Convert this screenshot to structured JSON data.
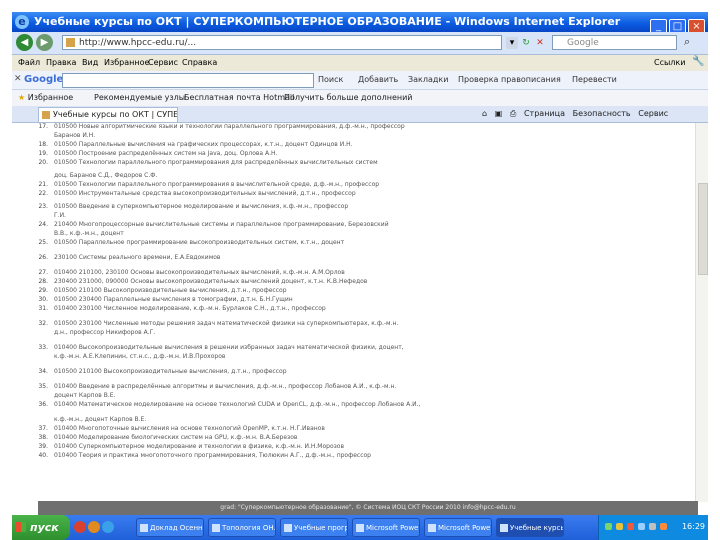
{
  "window": {
    "title": "Учебные курсы по ОКТ | СУПЕРКОМПЬЮТЕРНОЕ ОБРАЗОВАНИЕ - Windows Internet Explorer"
  },
  "address_bar": {
    "url": "http://www.hpcc-edu.ru/...",
    "search_placeholder": "Google"
  },
  "menu": [
    "Файл",
    "Правка",
    "Вид",
    "Избранное",
    "Сервис",
    "Справка"
  ],
  "menu_links": "Ссылки",
  "google_bar": {
    "logo": "Google",
    "buttons": [
      "Поиск",
      "Добавить",
      "Закладки",
      "Проверка правописания",
      "Перевести"
    ]
  },
  "favorites_bar": {
    "label": "Избранное",
    "items": [
      "Рекомендуемые узлы",
      "Бесплатная почта Hotmail",
      "Получить больше дополнений"
    ]
  },
  "tab": {
    "label": "Учебные курсы по ОКТ | СУПЕРКОМПЬЮТЕР..."
  },
  "command_bar": [
    "Страница",
    "Безопасность",
    "Сервис"
  ],
  "content": {
    "lines": [
      {
        "n": "17.",
        "t": "010500 Новые алгоритмические языки и технологии параллельного программирования, д.ф.-м.н., профессор"
      },
      {
        "n": "",
        "t": "Баранов И.Н."
      },
      {
        "n": "18.",
        "t": "010500 Параллельные вычисления на графических процессорах, к.т.н., доцент Одинцов И.Н."
      },
      {
        "n": "19.",
        "t": "010500 Построение распределённых систем на Java, доц. Орлова А.Н."
      },
      {
        "n": "20.",
        "t": "010500 Технологии параллельного программирования для распределённых вычислительных систем"
      },
      {
        "n": "",
        "t": "доц. Баранов С.Д., Федоров С.Ф."
      },
      {
        "n": "21.",
        "t": "010500 Технологии параллельного программирования в вычислительной среде, д.ф.-м.н., профессор"
      },
      {
        "n": "22.",
        "t": "010500 Инструментальные средства высокопроизводительных вычислений, д.т.н., профессор"
      },
      {
        "n": "23.",
        "t": "010500 Введение в суперкомпьютерное моделирование и вычисления, к.ф.-м.н., профессор"
      },
      {
        "n": "",
        "t": "Г.И."
      },
      {
        "n": "24.",
        "t": "210400 Многопроцессорные вычислительные системы и параллельное программирование, Березовский"
      },
      {
        "n": "",
        "t": "В.В., к.ф.-м.н., доцент"
      },
      {
        "n": "25.",
        "t": "010500 Параллельное программирование высокопроизводительных систем, к.т.н., доцент"
      },
      {
        "n": "26.",
        "t": "230100 Системы реального времени, Е.А.Евдокимов"
      },
      {
        "n": "27.",
        "t": "010400 210100, 230100 Основы высокопроизводительных вычислений, к.ф.-м.н. А.М.Орлов"
      },
      {
        "n": "28.",
        "t": "230400 231000, 090000 Основы высокопроизводительных вычислений доцент, к.т.н. К.В.Нефедов"
      },
      {
        "n": "29.",
        "t": "010500 210100 Высокопроизводительные вычисления, д.т.н., профессор"
      },
      {
        "n": "30.",
        "t": "010500 230400 Параллельные вычисления в томографии, д.т.н. Б.Н.Гущин"
      },
      {
        "n": "31.",
        "t": "010400 230100 Численное моделирование, к.ф.-м.н. Бурлаков С.Н., д.т.н., профессор"
      },
      {
        "n": "32.",
        "t": "010500 230100 Численные методы решения задач математической физики на суперкомпьютерах, к.ф.-м.н."
      },
      {
        "n": "",
        "t": "д.н., профессор Никифоров А.Г."
      },
      {
        "n": "33.",
        "t": "010400 Высокопроизводительные вычисления в решении избранных задач математической физики, доцент,"
      },
      {
        "n": "",
        "t": "к.ф.-м.н. А.Е.Клепинин, ст.н.с., д.ф.-м.н. И.В.Прохоров"
      },
      {
        "n": "34.",
        "t": "010500 210100 Высокопроизводительные вычисления, д.т.н., профессор"
      },
      {
        "n": "35.",
        "t": "010400 Введение в распределённые алгоритмы и вычисления, д.ф.-м.н., профессор Лобанов А.И., к.ф.-м.н."
      },
      {
        "n": "",
        "t": "доцент Карпов В.Е."
      },
      {
        "n": "36.",
        "t": "010400 Математическое моделирование на основе технологий CUDA и OpenCL, д.ф.-м.н., профессор Лобанов А.И.,"
      },
      {
        "n": "",
        "t": "к.ф.-м.н., доцент Карпов В.Е."
      },
      {
        "n": "37.",
        "t": "010400 Многопоточные вычисления на основе технологий OpenMP, к.т.н. Н.Г.Иванов"
      },
      {
        "n": "38.",
        "t": "010400 Моделирование биологических систем на GPU, к.ф.-м.н. В.А.Березов"
      },
      {
        "n": "39.",
        "t": "010400 Суперкомпьютерное моделирование и технологии в физике, к.ф.-м.н. И.Н.Морозов"
      },
      {
        "n": "40.",
        "t": "010400 Теория и практика многопоточного программирования, Тюлюкин А.Г., д.ф.-м.н., профессор"
      }
    ],
    "footer": "grad: \"Суперкомпьютерное образование\", © Система ИОЦ СКТ России 2010   info@hpcc-edu.ru"
  },
  "taskbar": {
    "start": "пуск",
    "buttons": [
      "Доклад Осенн...",
      "Топология ОН...",
      "Учебные прогр...",
      "Microsoft Power...",
      "Microsoft Power...",
      "Учебные курсы..."
    ],
    "clock": "16:29"
  }
}
